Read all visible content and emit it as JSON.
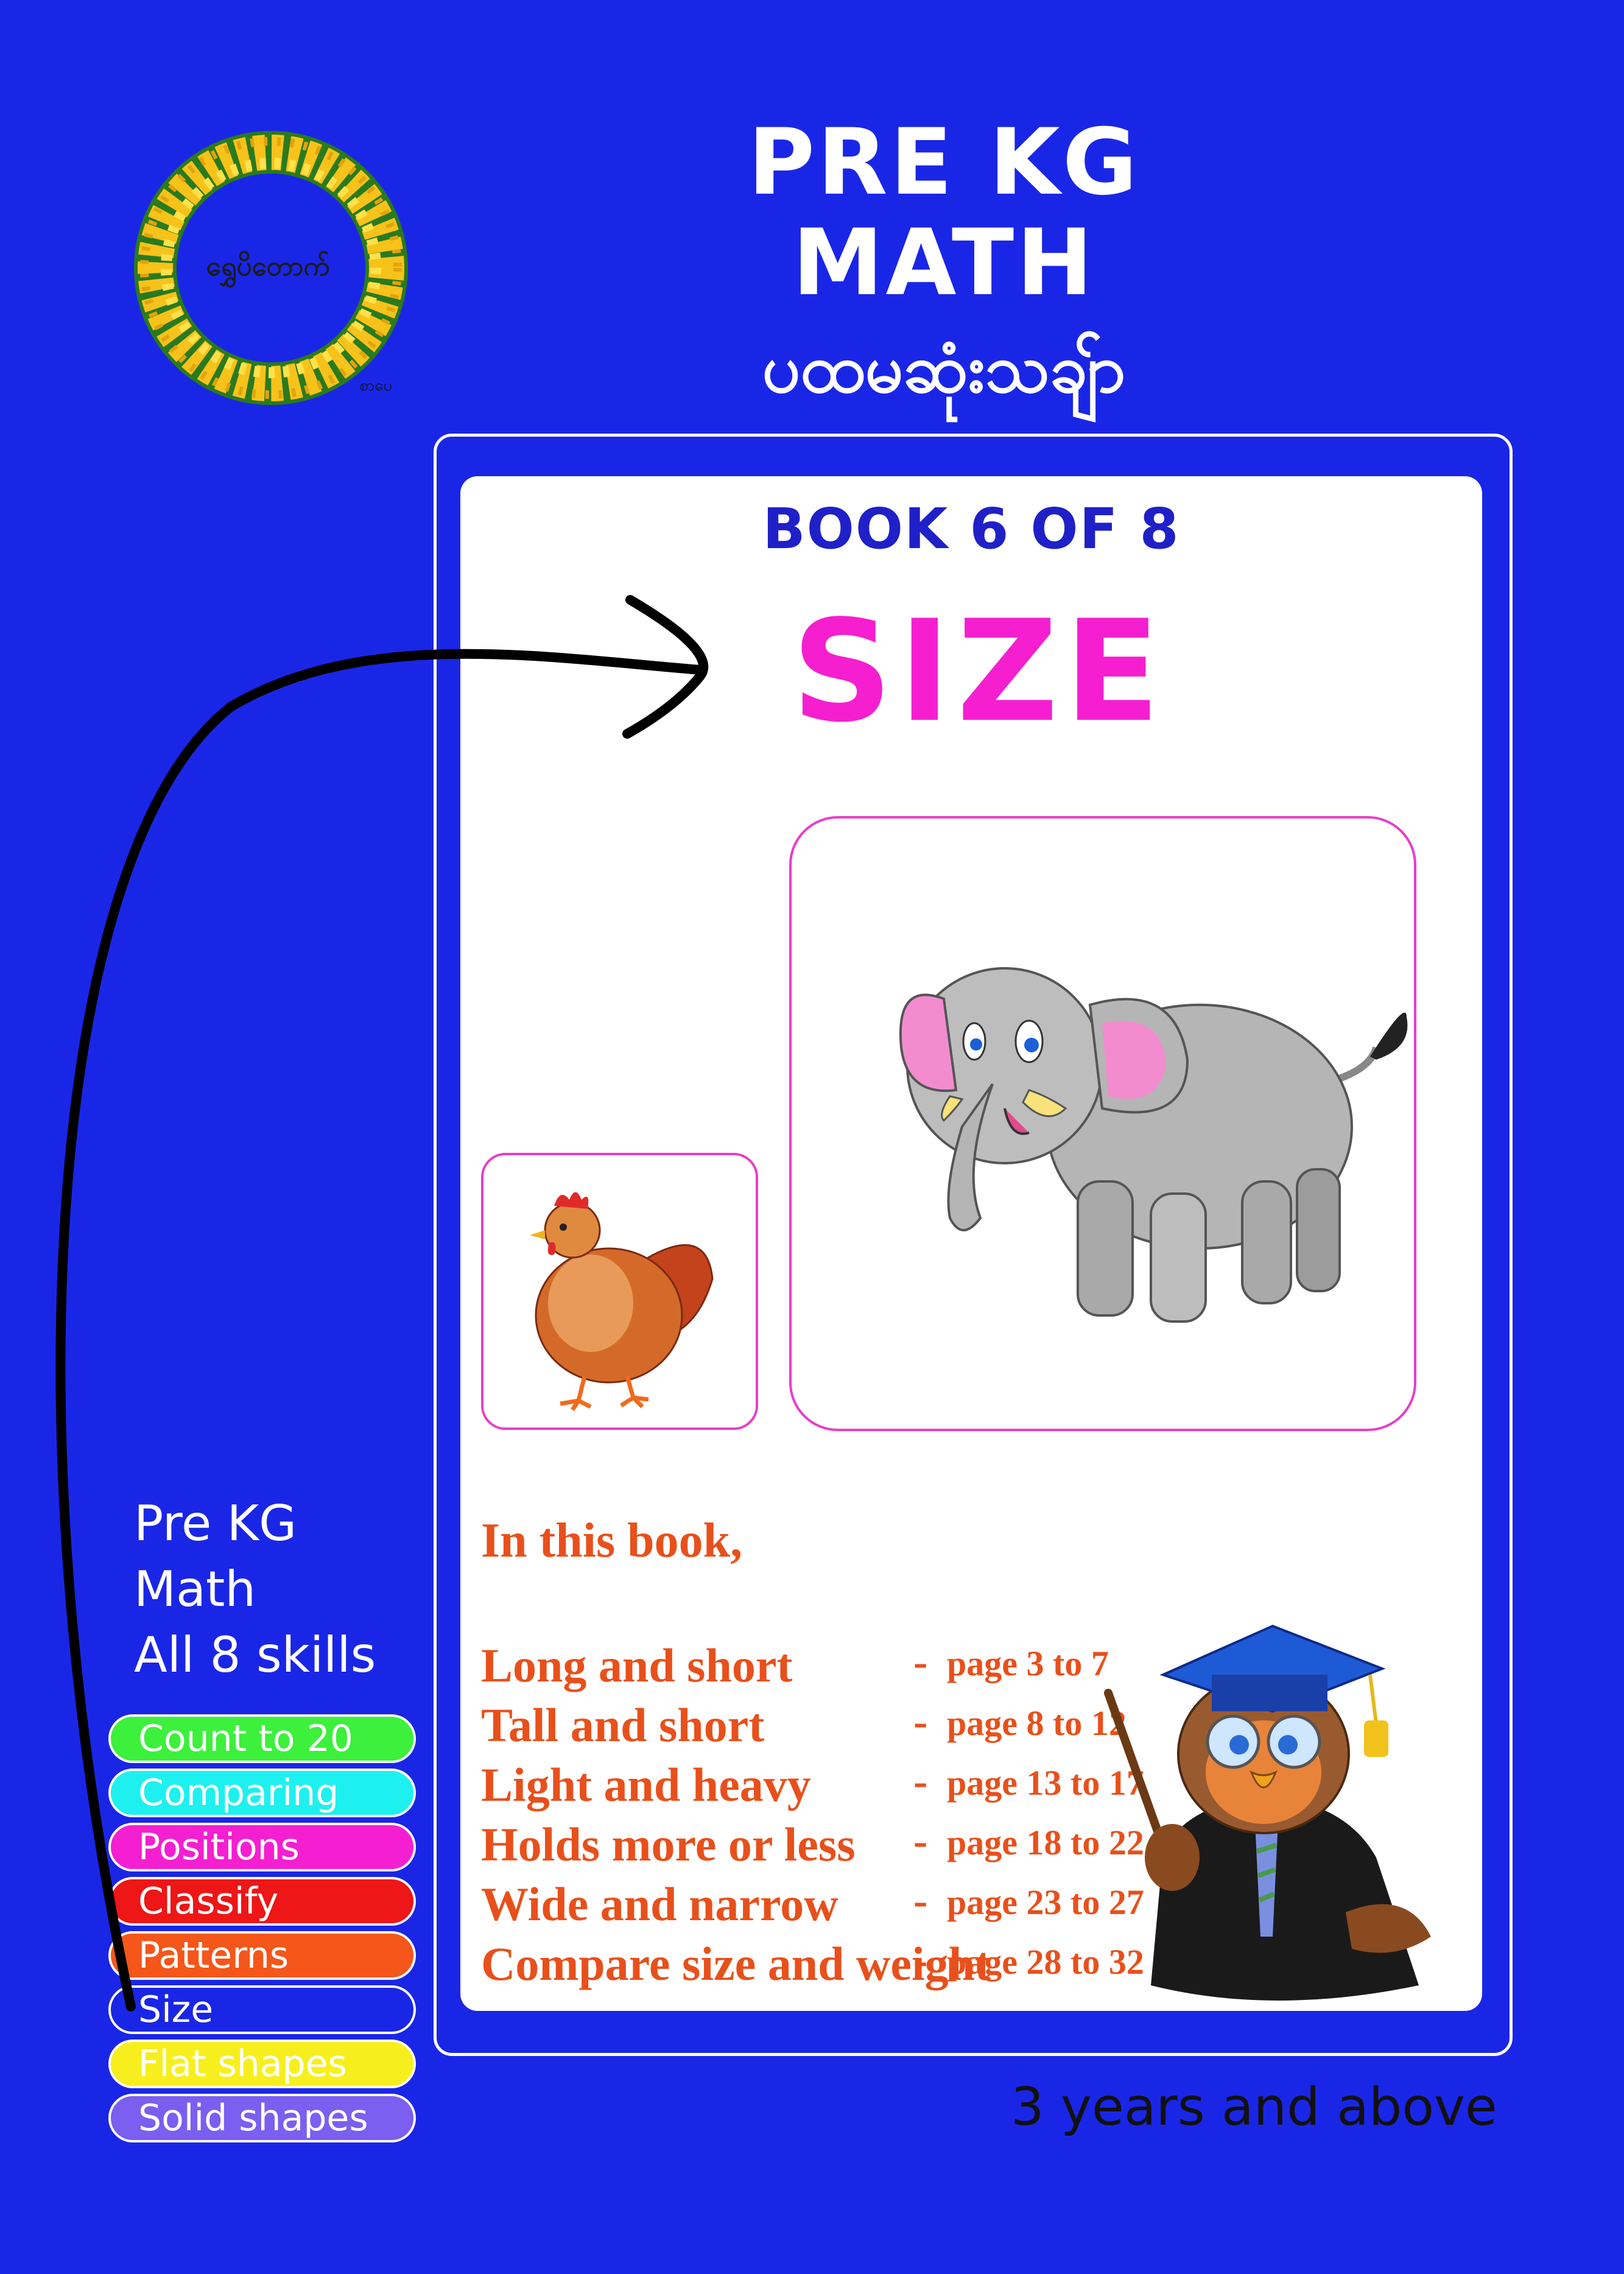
{
  "logo": {
    "text": "ရွှေပိတောက်",
    "sub": "စာပေ"
  },
  "header": {
    "line1": "PRE KG",
    "line2": "MATH",
    "line3": "ပထမဆုံးသချ်ာ"
  },
  "card": {
    "book_label": "BOOK 6 OF 8",
    "topic": "SIZE",
    "intro": "In this book,",
    "topics": [
      {
        "name": "Long and short",
        "pages": "page 3 to 7"
      },
      {
        "name": "Tall and short",
        "pages": "page 8 to 12"
      },
      {
        "name": "Light and heavy",
        "pages": "page 13 to 17"
      },
      {
        "name": "Holds more or less",
        "pages": "page 18 to 22"
      },
      {
        "name": "Wide and narrow",
        "pages": "page 23 to 27"
      },
      {
        "name": "Compare size and weight",
        "pages": "page 28 to 32"
      }
    ]
  },
  "side": {
    "line1": "Pre KG",
    "line2": "Math",
    "line3": "All 8 skills",
    "skills": [
      {
        "label": "Count to 20",
        "color": "#3cf03c"
      },
      {
        "label": "Comparing",
        "color": "#1ef0ef"
      },
      {
        "label": "Positions",
        "color": "#f41fd1"
      },
      {
        "label": "Classify",
        "color": "#ee1616"
      },
      {
        "label": "Patterns",
        "color": "#f5561a"
      },
      {
        "label": "Size",
        "color": "#1a26e6"
      },
      {
        "label": "Flat shapes",
        "color": "#f7ef1d"
      },
      {
        "label": "Solid shapes",
        "color": "#7a5ff0"
      }
    ]
  },
  "footer": {
    "age": "3 years and above"
  },
  "colors": {
    "background": "#1a26e6",
    "title_pink": "#f51fd0",
    "book_blue": "#2020c8",
    "text_orange": "#e8501b",
    "frame_pink": "#e83ec8"
  }
}
